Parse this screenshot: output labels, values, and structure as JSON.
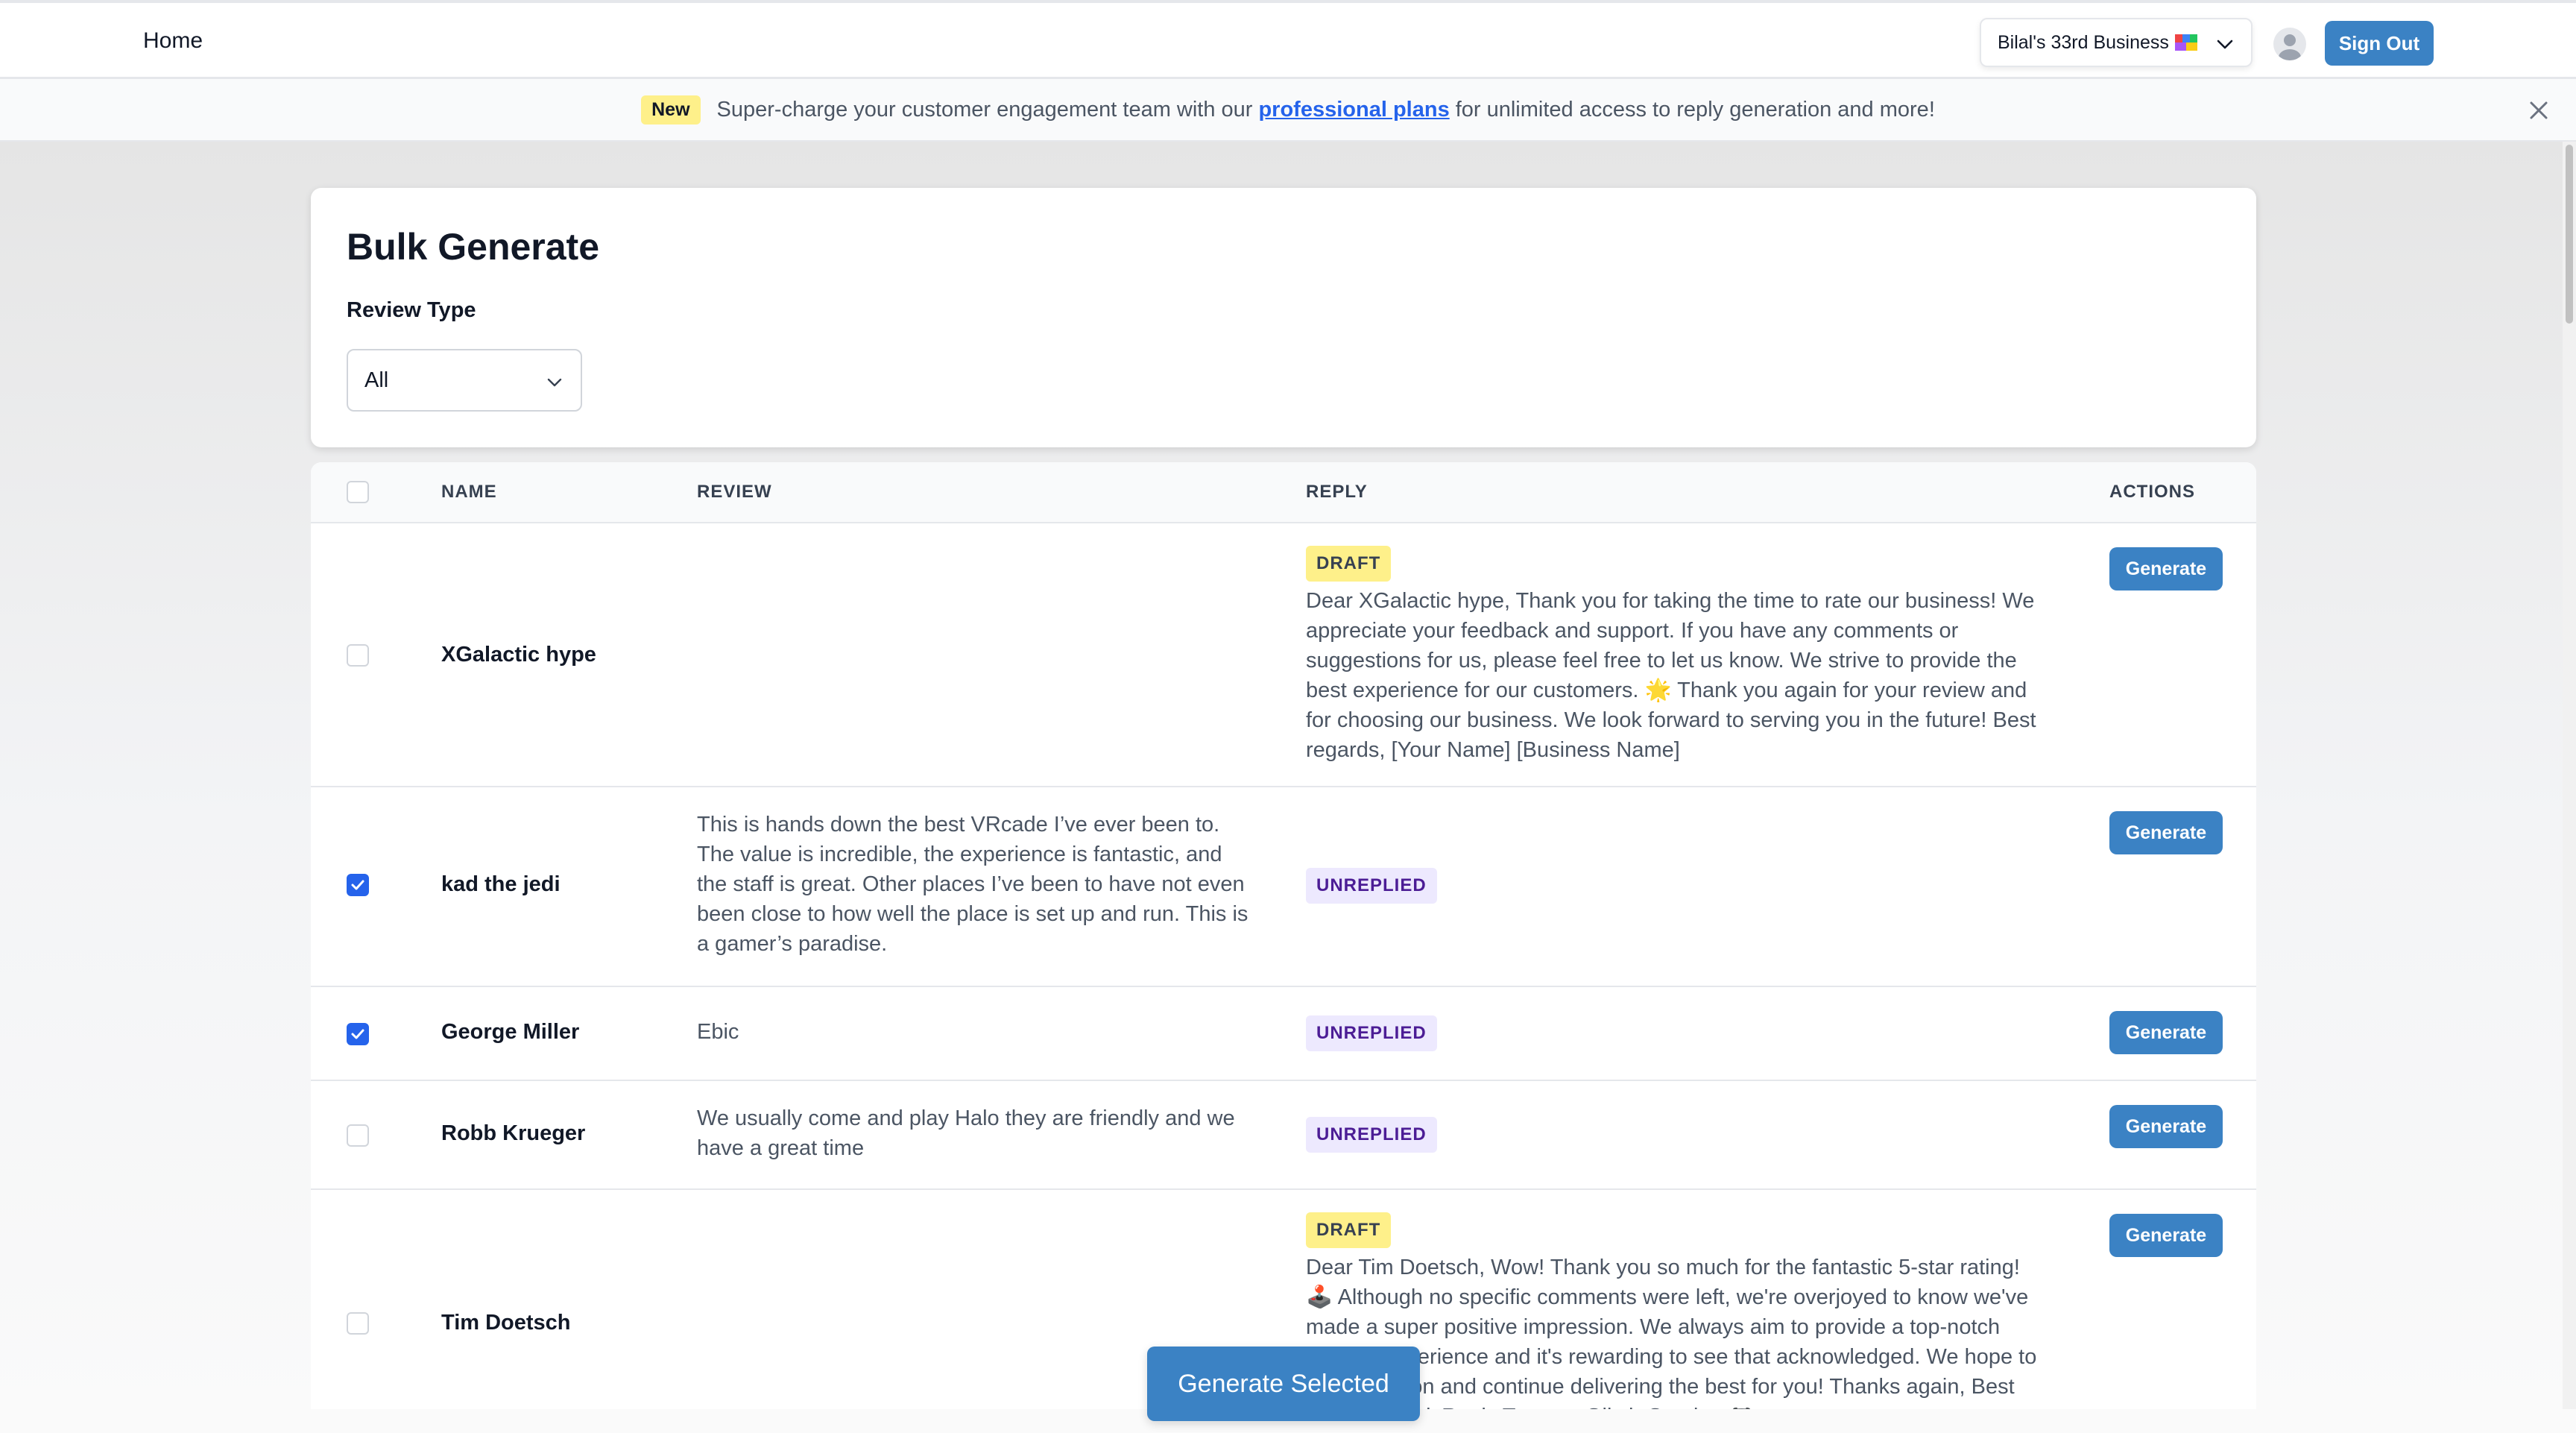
{
  "nav": {
    "home_label": "Home",
    "business_selector": "Bilal's 33rd Business",
    "signout_label": "Sign Out",
    "brand_color": "#3b82c4"
  },
  "banner": {
    "badge": "New",
    "text_before": "Super-charge your customer engagement team with our",
    "link_text": "professional plans",
    "text_after": "for unlimited access to reply generation and more!"
  },
  "card": {
    "title": "Bulk Generate",
    "review_type_label": "Review Type",
    "review_type_value": "All"
  },
  "table": {
    "columns": [
      "NAME",
      "REVIEW",
      "REPLY",
      "ACTIONS"
    ],
    "generate_label": "Generate",
    "rows": [
      {
        "checked": false,
        "name": "XGalactic hype",
        "review": "",
        "status": "DRAFT",
        "reply": "Dear XGalactic hype, Thank you for taking the time to rate our business! We appreciate your feedback and support. If you have any comments or suggestions for us, please feel free to let us know. We strive to provide the best experience for our customers. 🌟 Thank you again for your review and for choosing our business. We look forward to serving you in the future! Best regards, [Your Name] [Business Name]"
      },
      {
        "checked": true,
        "name": "kad the jedi",
        "review": "This is hands down the best VRcade I’ve ever been to. The value is incredible, the experience is fantastic, and the staff is great. Other places I’ve been to have not even been close to how well the place is set up and run. This is a gamer’s paradise.",
        "status": "UNREPLIED",
        "reply": ""
      },
      {
        "checked": true,
        "name": "George Miller",
        "review": "Ebic",
        "status": "UNREPLIED",
        "reply": ""
      },
      {
        "checked": false,
        "name": "Robb Krueger",
        "review": "We usually come and play Halo they are friendly and we have a great time",
        "status": "UNREPLIED",
        "reply": ""
      },
      {
        "checked": false,
        "name": "Tim Doetsch",
        "review": "",
        "status": "DRAFT",
        "reply": "Dear Tim Doetsch, Wow! Thank you so much for the fantastic 5-star rating! 🕹️ Although no specific comments were left, we're overjoyed to know we've made a super positive impression. We always aim to provide a top-notch gaming experience and it's rewarding to see that acknowledged. We hope to see you soon and continue delivering the best for you! Thanks again, Best wishes, MagicReply Team at Glitch Gaming 🎮"
      }
    ]
  },
  "footer": {
    "generate_selected_label": "Generate Selected"
  }
}
